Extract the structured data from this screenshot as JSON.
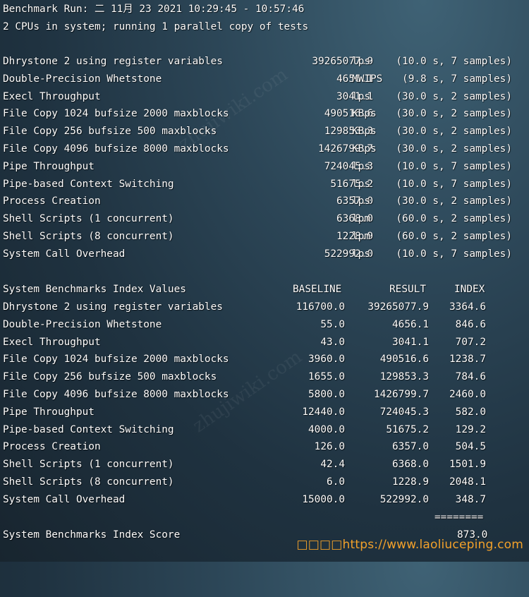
{
  "header": {
    "run_line": "Benchmark Run: 二 11月 23 2021 10:29:45 - 10:57:46",
    "cpu_line": "2 CPUs in system; running 1 parallel copy of tests"
  },
  "tests": [
    {
      "name": "Dhrystone 2 using register variables",
      "result": "39265077.9",
      "unit": "lps",
      "detail": "(10.0 s, 7 samples)"
    },
    {
      "name": "Double-Precision Whetstone",
      "result": "4656.1",
      "unit": "MWIPS",
      "detail": "(9.8 s, 7 samples)"
    },
    {
      "name": "Execl Throughput",
      "result": "3041.1",
      "unit": "lps",
      "detail": "(30.0 s, 2 samples)"
    },
    {
      "name": "File Copy 1024 bufsize 2000 maxblocks",
      "result": "490516.6",
      "unit": "KBps",
      "detail": "(30.0 s, 2 samples)"
    },
    {
      "name": "File Copy 256 bufsize 500 maxblocks",
      "result": "129853.3",
      "unit": "KBps",
      "detail": "(30.0 s, 2 samples)"
    },
    {
      "name": "File Copy 4096 bufsize 8000 maxblocks",
      "result": "1426799.7",
      "unit": "KBps",
      "detail": "(30.0 s, 2 samples)"
    },
    {
      "name": "Pipe Throughput",
      "result": "724045.3",
      "unit": "lps",
      "detail": "(10.0 s, 7 samples)"
    },
    {
      "name": "Pipe-based Context Switching",
      "result": "51675.2",
      "unit": "lps",
      "detail": "(10.0 s, 7 samples)"
    },
    {
      "name": "Process Creation",
      "result": "6357.0",
      "unit": "lps",
      "detail": "(30.0 s, 2 samples)"
    },
    {
      "name": "Shell Scripts (1 concurrent)",
      "result": "6368.0",
      "unit": "lpm",
      "detail": "(60.0 s, 2 samples)"
    },
    {
      "name": "Shell Scripts (8 concurrent)",
      "result": "1228.9",
      "unit": "lpm",
      "detail": "(60.0 s, 2 samples)"
    },
    {
      "name": "System Call Overhead",
      "result": "522992.0",
      "unit": "lps",
      "detail": "(10.0 s, 7 samples)"
    }
  ],
  "index_table": {
    "title": "System Benchmarks Index Values",
    "col_baseline": "BASELINE",
    "col_result": "RESULT",
    "col_index": "INDEX",
    "rows": [
      {
        "name": "Dhrystone 2 using register variables",
        "baseline": "116700.0",
        "result": "39265077.9",
        "index": "3364.6"
      },
      {
        "name": "Double-Precision Whetstone",
        "baseline": "55.0",
        "result": "4656.1",
        "index": "846.6"
      },
      {
        "name": "Execl Throughput",
        "baseline": "43.0",
        "result": "3041.1",
        "index": "707.2"
      },
      {
        "name": "File Copy 1024 bufsize 2000 maxblocks",
        "baseline": "3960.0",
        "result": "490516.6",
        "index": "1238.7"
      },
      {
        "name": "File Copy 256 bufsize 500 maxblocks",
        "baseline": "1655.0",
        "result": "129853.3",
        "index": "784.6"
      },
      {
        "name": "File Copy 4096 bufsize 8000 maxblocks",
        "baseline": "5800.0",
        "result": "1426799.7",
        "index": "2460.0"
      },
      {
        "name": "Pipe Throughput",
        "baseline": "12440.0",
        "result": "724045.3",
        "index": "582.0"
      },
      {
        "name": "Pipe-based Context Switching",
        "baseline": "4000.0",
        "result": "51675.2",
        "index": "129.2"
      },
      {
        "name": "Process Creation",
        "baseline": "126.0",
        "result": "6357.0",
        "index": "504.5"
      },
      {
        "name": "Shell Scripts (1 concurrent)",
        "baseline": "42.4",
        "result": "6368.0",
        "index": "1501.9"
      },
      {
        "name": "Shell Scripts (8 concurrent)",
        "baseline": "6.0",
        "result": "1228.9",
        "index": "2048.1"
      },
      {
        "name": "System Call Overhead",
        "baseline": "15000.0",
        "result": "522992.0",
        "index": "348.7"
      }
    ],
    "separator": "========",
    "score_label": "System Benchmarks Index Score",
    "score_value": "873.0"
  },
  "watermark": {
    "text": "https://www.laoliuceping.com",
    "prefix_glyphs": "□□□□",
    "color": "#f2a12a"
  }
}
